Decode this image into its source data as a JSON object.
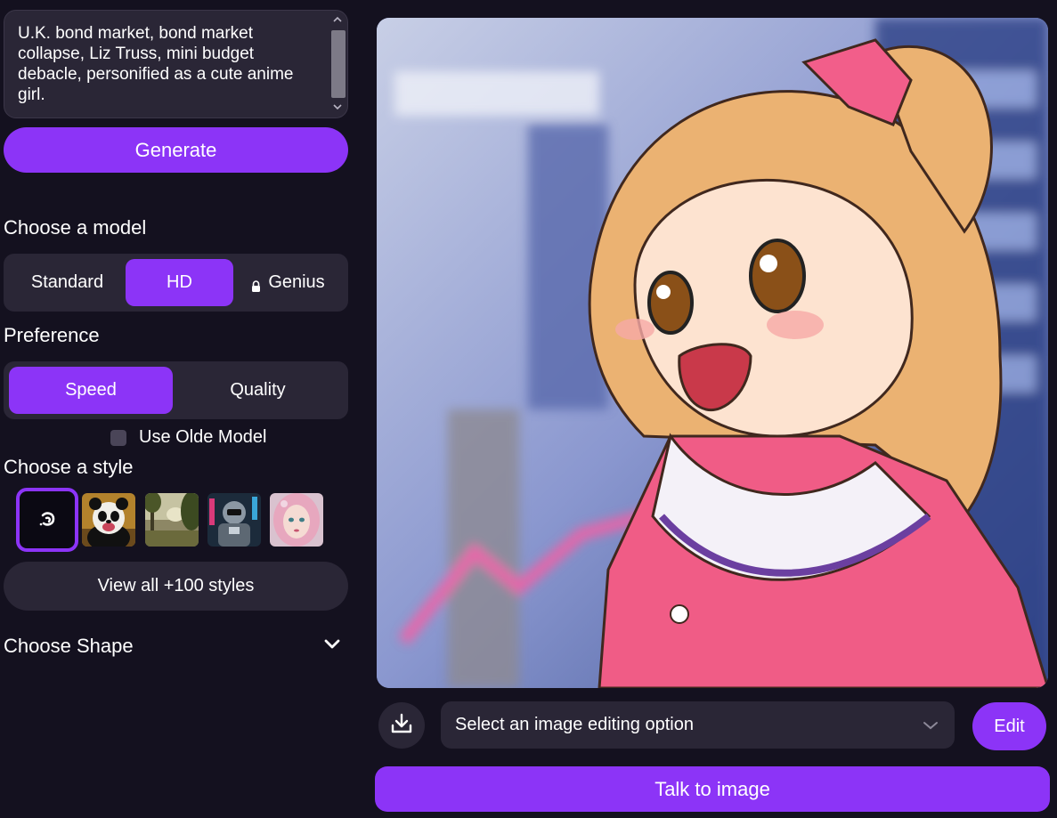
{
  "prompt": {
    "text": "U.K. bond market, bond market collapse, Liz Truss, mini budget debacle, personified as a cute anime girl."
  },
  "generate_label": "Generate",
  "model": {
    "heading": "Choose a model",
    "options": [
      "Standard",
      "HD",
      "Genius"
    ],
    "selected": "HD",
    "locked": [
      "Genius"
    ]
  },
  "preference": {
    "heading": "Preference",
    "options": [
      "Speed",
      "Quality"
    ],
    "selected": "Speed"
  },
  "olde_model": {
    "label": "Use Olde Model",
    "checked": false
  },
  "style": {
    "heading": "Choose a style",
    "thumbnails": [
      "no-style-icon",
      "panda-style",
      "landscape-style",
      "robot-style",
      "portrait-style"
    ],
    "selected": "no-style-icon",
    "view_all_label": "View all +100 styles"
  },
  "shape": {
    "heading": "Choose Shape"
  },
  "editing": {
    "placeholder": "Select an image editing option",
    "edit_label": "Edit",
    "talk_label": "Talk to image"
  },
  "colors": {
    "accent": "#8c34f7",
    "background": "#14111f",
    "surface": "#2a2636"
  }
}
